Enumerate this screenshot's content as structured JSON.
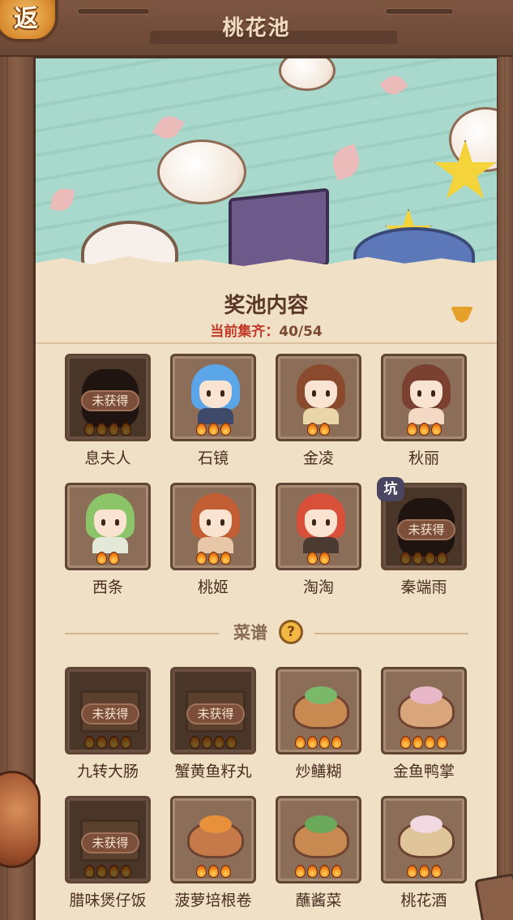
{
  "page": {
    "title": "桃花池",
    "back_label": "返"
  },
  "pool": {
    "section_title": "奖池内容",
    "collect_label": "当前集齐：",
    "collect_value": "40/54"
  },
  "characters": [
    {
      "name": "息夫人",
      "locked": true,
      "status": "未获得",
      "stars": 4
    },
    {
      "name": "石镜",
      "locked": false,
      "stars": 3,
      "hair": "#5aa6e8",
      "body": "#3f4a6a"
    },
    {
      "name": "金凌",
      "locked": false,
      "stars": 2,
      "hair": "#8a4a2e",
      "body": "#e8d5a8"
    },
    {
      "name": "秋丽",
      "locked": false,
      "stars": 3,
      "hair": "#7a4030",
      "body": "#f3d9c4"
    },
    {
      "name": "西条",
      "locked": false,
      "stars": 2,
      "hair": "#8cc46a",
      "body": "#e3e8d8"
    },
    {
      "name": "桃姬",
      "locked": false,
      "stars": 3,
      "hair": "#c25e34",
      "body": "#e8c6a8"
    },
    {
      "name": "淘淘",
      "locked": false,
      "stars": 2,
      "hair": "#d8503a",
      "body": "#4a3a32"
    },
    {
      "name": "秦端雨",
      "locked": true,
      "status": "未获得",
      "stars": 4,
      "badge": "坑"
    }
  ],
  "recipes": {
    "title": "菜谱",
    "help_icon": "?",
    "items": [
      {
        "name": "九转大肠",
        "locked": true,
        "status": "未获得",
        "stars": 4
      },
      {
        "name": "蟹黄鱼籽丸",
        "locked": true,
        "status": "未获得",
        "stars": 4
      },
      {
        "name": "炒鳝糊",
        "locked": false,
        "stars": 4,
        "color": "#c98a52",
        "top": "#7ab86a"
      },
      {
        "name": "金鱼鸭掌",
        "locked": false,
        "stars": 4,
        "color": "#d8a67a",
        "top": "#e8b8c8"
      },
      {
        "name": "腊味煲仔饭",
        "locked": true,
        "status": "未获得",
        "stars": 4
      },
      {
        "name": "菠萝培根卷",
        "locked": false,
        "stars": 3,
        "color": "#c67a4a",
        "top": "#e8903a"
      },
      {
        "name": "蘸酱菜",
        "locked": false,
        "stars": 4,
        "color": "#c98a52",
        "top": "#6aa85a"
      },
      {
        "name": "桃花酒",
        "locked": false,
        "stars": 3,
        "color": "#e0c49a",
        "top": "#f2d8e0"
      }
    ]
  },
  "colors": {
    "panel_bg": "#efe0c6",
    "frame_wood": "#6e4b38",
    "accent_red": "#c23a2a",
    "flame": "#f28a1c"
  },
  "icons": [
    "back-button-icon",
    "dropdown-arrow-icon",
    "help-icon",
    "flame-star-icon"
  ]
}
